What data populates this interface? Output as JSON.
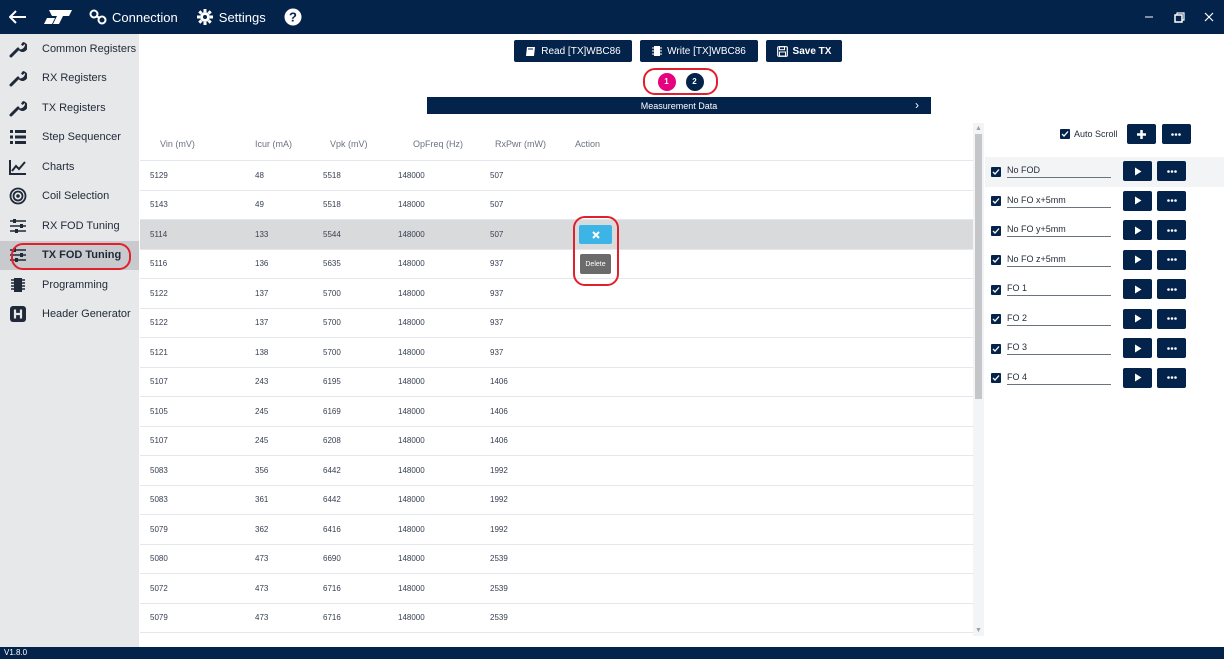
{
  "titlebar": {
    "connection_label": "Connection",
    "settings_label": "Settings"
  },
  "sidebar": {
    "items": [
      {
        "label": "Common Registers",
        "icon": "wrench-icon"
      },
      {
        "label": "RX Registers",
        "icon": "wrench-icon"
      },
      {
        "label": "TX Registers",
        "icon": "wrench-icon"
      },
      {
        "label": "Step Sequencer",
        "icon": "list-icon"
      },
      {
        "label": "Charts",
        "icon": "chart-icon"
      },
      {
        "label": "Coil Selection",
        "icon": "coil-icon"
      },
      {
        "label": "RX FOD Tuning",
        "icon": "sliders-icon"
      },
      {
        "label": "TX FOD Tuning",
        "icon": "sliders-icon",
        "active": true
      },
      {
        "label": "Programming",
        "icon": "chip-icon"
      },
      {
        "label": "Header Generator",
        "icon": "header-icon"
      }
    ]
  },
  "toolbar": {
    "read_label": "Read [TX]WBC86",
    "write_label": "Write [TX]WBC86",
    "save_label": "Save TX"
  },
  "pager": {
    "pages": [
      "1",
      "2"
    ],
    "current": "1"
  },
  "measurement": {
    "title": "Measurement Data"
  },
  "table": {
    "headers": [
      "Vin (mV)",
      "Icur (mA)",
      "Vpk (mV)",
      "OpFreq (Hz)",
      "RxPwr (mW)",
      "Action"
    ],
    "rows": [
      [
        "5129",
        "48",
        "5518",
        "148000",
        "507"
      ],
      [
        "5143",
        "49",
        "5518",
        "148000",
        "507"
      ],
      [
        "5114",
        "133",
        "5544",
        "148000",
        "507"
      ],
      [
        "5116",
        "136",
        "5635",
        "148000",
        "937"
      ],
      [
        "5122",
        "137",
        "5700",
        "148000",
        "937"
      ],
      [
        "5122",
        "137",
        "5700",
        "148000",
        "937"
      ],
      [
        "5121",
        "138",
        "5700",
        "148000",
        "937"
      ],
      [
        "5107",
        "243",
        "6195",
        "148000",
        "1406"
      ],
      [
        "5105",
        "245",
        "6169",
        "148000",
        "1406"
      ],
      [
        "5107",
        "245",
        "6208",
        "148000",
        "1406"
      ],
      [
        "5083",
        "356",
        "6442",
        "148000",
        "1992"
      ],
      [
        "5083",
        "361",
        "6442",
        "148000",
        "1992"
      ],
      [
        "5079",
        "362",
        "6416",
        "148000",
        "1992"
      ],
      [
        "5080",
        "473",
        "6690",
        "148000",
        "2539"
      ],
      [
        "5072",
        "473",
        "6716",
        "148000",
        "2539"
      ],
      [
        "5079",
        "473",
        "6716",
        "148000",
        "2539"
      ]
    ],
    "selected_row": 2,
    "delete_label": "Delete"
  },
  "right_panel": {
    "auto_scroll_label": "Auto Scroll",
    "fod_items": [
      "No FOD",
      "No FO x+5mm",
      "No FO y+5mm",
      "No FO z+5mm",
      "FO 1",
      "FO 2",
      "FO 3",
      "FO 4"
    ]
  },
  "footer": {
    "version": "V1.8.0"
  },
  "colors": {
    "navy": "#03234b",
    "magenta": "#e6007e",
    "highlight_red": "#e0202c",
    "close_blue": "#3cb4e5"
  }
}
